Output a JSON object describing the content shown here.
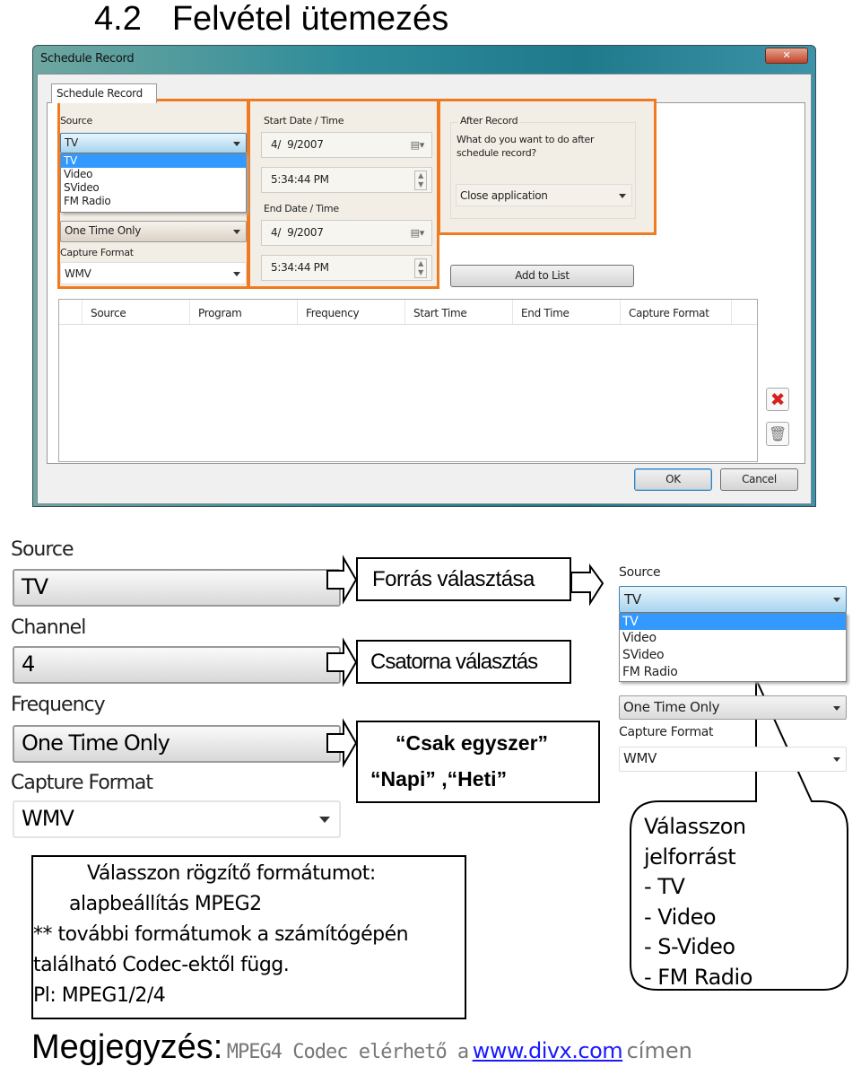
{
  "heading": {
    "number": "4.2",
    "title": "Felvétel ütemezés"
  },
  "dialog": {
    "title": "Schedule Record",
    "tab": "Schedule Record",
    "source": {
      "label": "Source",
      "value": "TV",
      "options": [
        "TV",
        "Video",
        "SVideo",
        "FM Radio"
      ],
      "selected": "TV"
    },
    "frequency": {
      "value": "One Time Only"
    },
    "capture_format": {
      "label": "Capture Format",
      "value": "WMV"
    },
    "start": {
      "label": "Start Date / Time",
      "date": "4/  9/2007",
      "time": "5:34:44 PM"
    },
    "end": {
      "label": "End Date / Time",
      "date": "4/  9/2007",
      "time": "5:34:44 PM"
    },
    "after": {
      "label": "After Record",
      "question": "What do you want to do after schedule record?",
      "value": "Close application"
    },
    "add_button": "Add to List",
    "columns": [
      "Source",
      "Program",
      "Frequency",
      "Start Time",
      "End Time",
      "Capture Format"
    ],
    "ok": "OK",
    "cancel": "Cancel",
    "highlight_color": "#f07a20"
  },
  "detail": {
    "source_label": "Source",
    "source_value": "TV",
    "channel_label": "Channel",
    "channel_value": "4",
    "frequency_label": "Frequency",
    "frequency_value": "One Time Only",
    "format_label": "Capture Format",
    "format_value": "WMV"
  },
  "callouts": {
    "source": "Forrás választása",
    "channel": "Csatorna választás",
    "freq_line1": "“Csak egyszer”",
    "freq_line2": "“Napi” ,“Heti”",
    "format": [
      "Válasszon rögzítő formátumot:",
      "alapbeállítás MPEG2",
      "** további formátumok a számítógépén",
      "található Codec-ektől függ.",
      "Pl: MPEG1/2/4"
    ],
    "bubble": [
      "Válasszon",
      "jelforrást",
      "- TV",
      "- Video",
      "- S-Video",
      "- FM Radio"
    ]
  },
  "mini": {
    "source_label": "Source",
    "source_value": "TV",
    "options": [
      "TV",
      "Video",
      "SVideo",
      "FM Radio"
    ],
    "frequency_value": "One Time Only",
    "format_label": "Capture Format",
    "format_value": "WMV"
  },
  "note": {
    "label": "Megjegyzés:",
    "text": "MPEG4 Codec elérhető a",
    "link": "www.divx.com",
    "suffix": "címen"
  }
}
